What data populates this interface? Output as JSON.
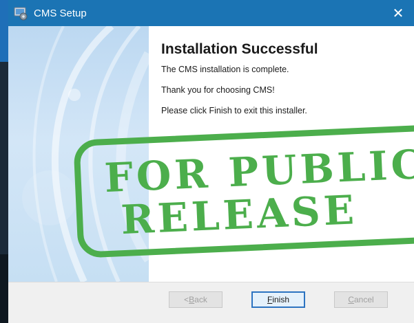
{
  "window": {
    "title": "CMS Setup",
    "close_glyph": "✕"
  },
  "content": {
    "heading": "Installation Successful",
    "line1": "The CMS  installation is complete.",
    "line2": "Thank you for choosing CMS!",
    "line3": "Please click Finish to exit this installer."
  },
  "buttons": {
    "back_prefix": "< ",
    "back_key": "B",
    "back_rest": "ack",
    "finish_key": "F",
    "finish_rest": "inish",
    "cancel_key": "C",
    "cancel_rest": "ancel"
  },
  "stamp": {
    "line1": "FOR PUBLIC",
    "line2": "RELEASE",
    "color": "#4cae4c"
  },
  "colors": {
    "titlebar": "#1b74b4",
    "banner": "#c6dff3",
    "primary_border": "#2c73c1"
  },
  "icons": [
    "installer-icon",
    "close-icon"
  ]
}
